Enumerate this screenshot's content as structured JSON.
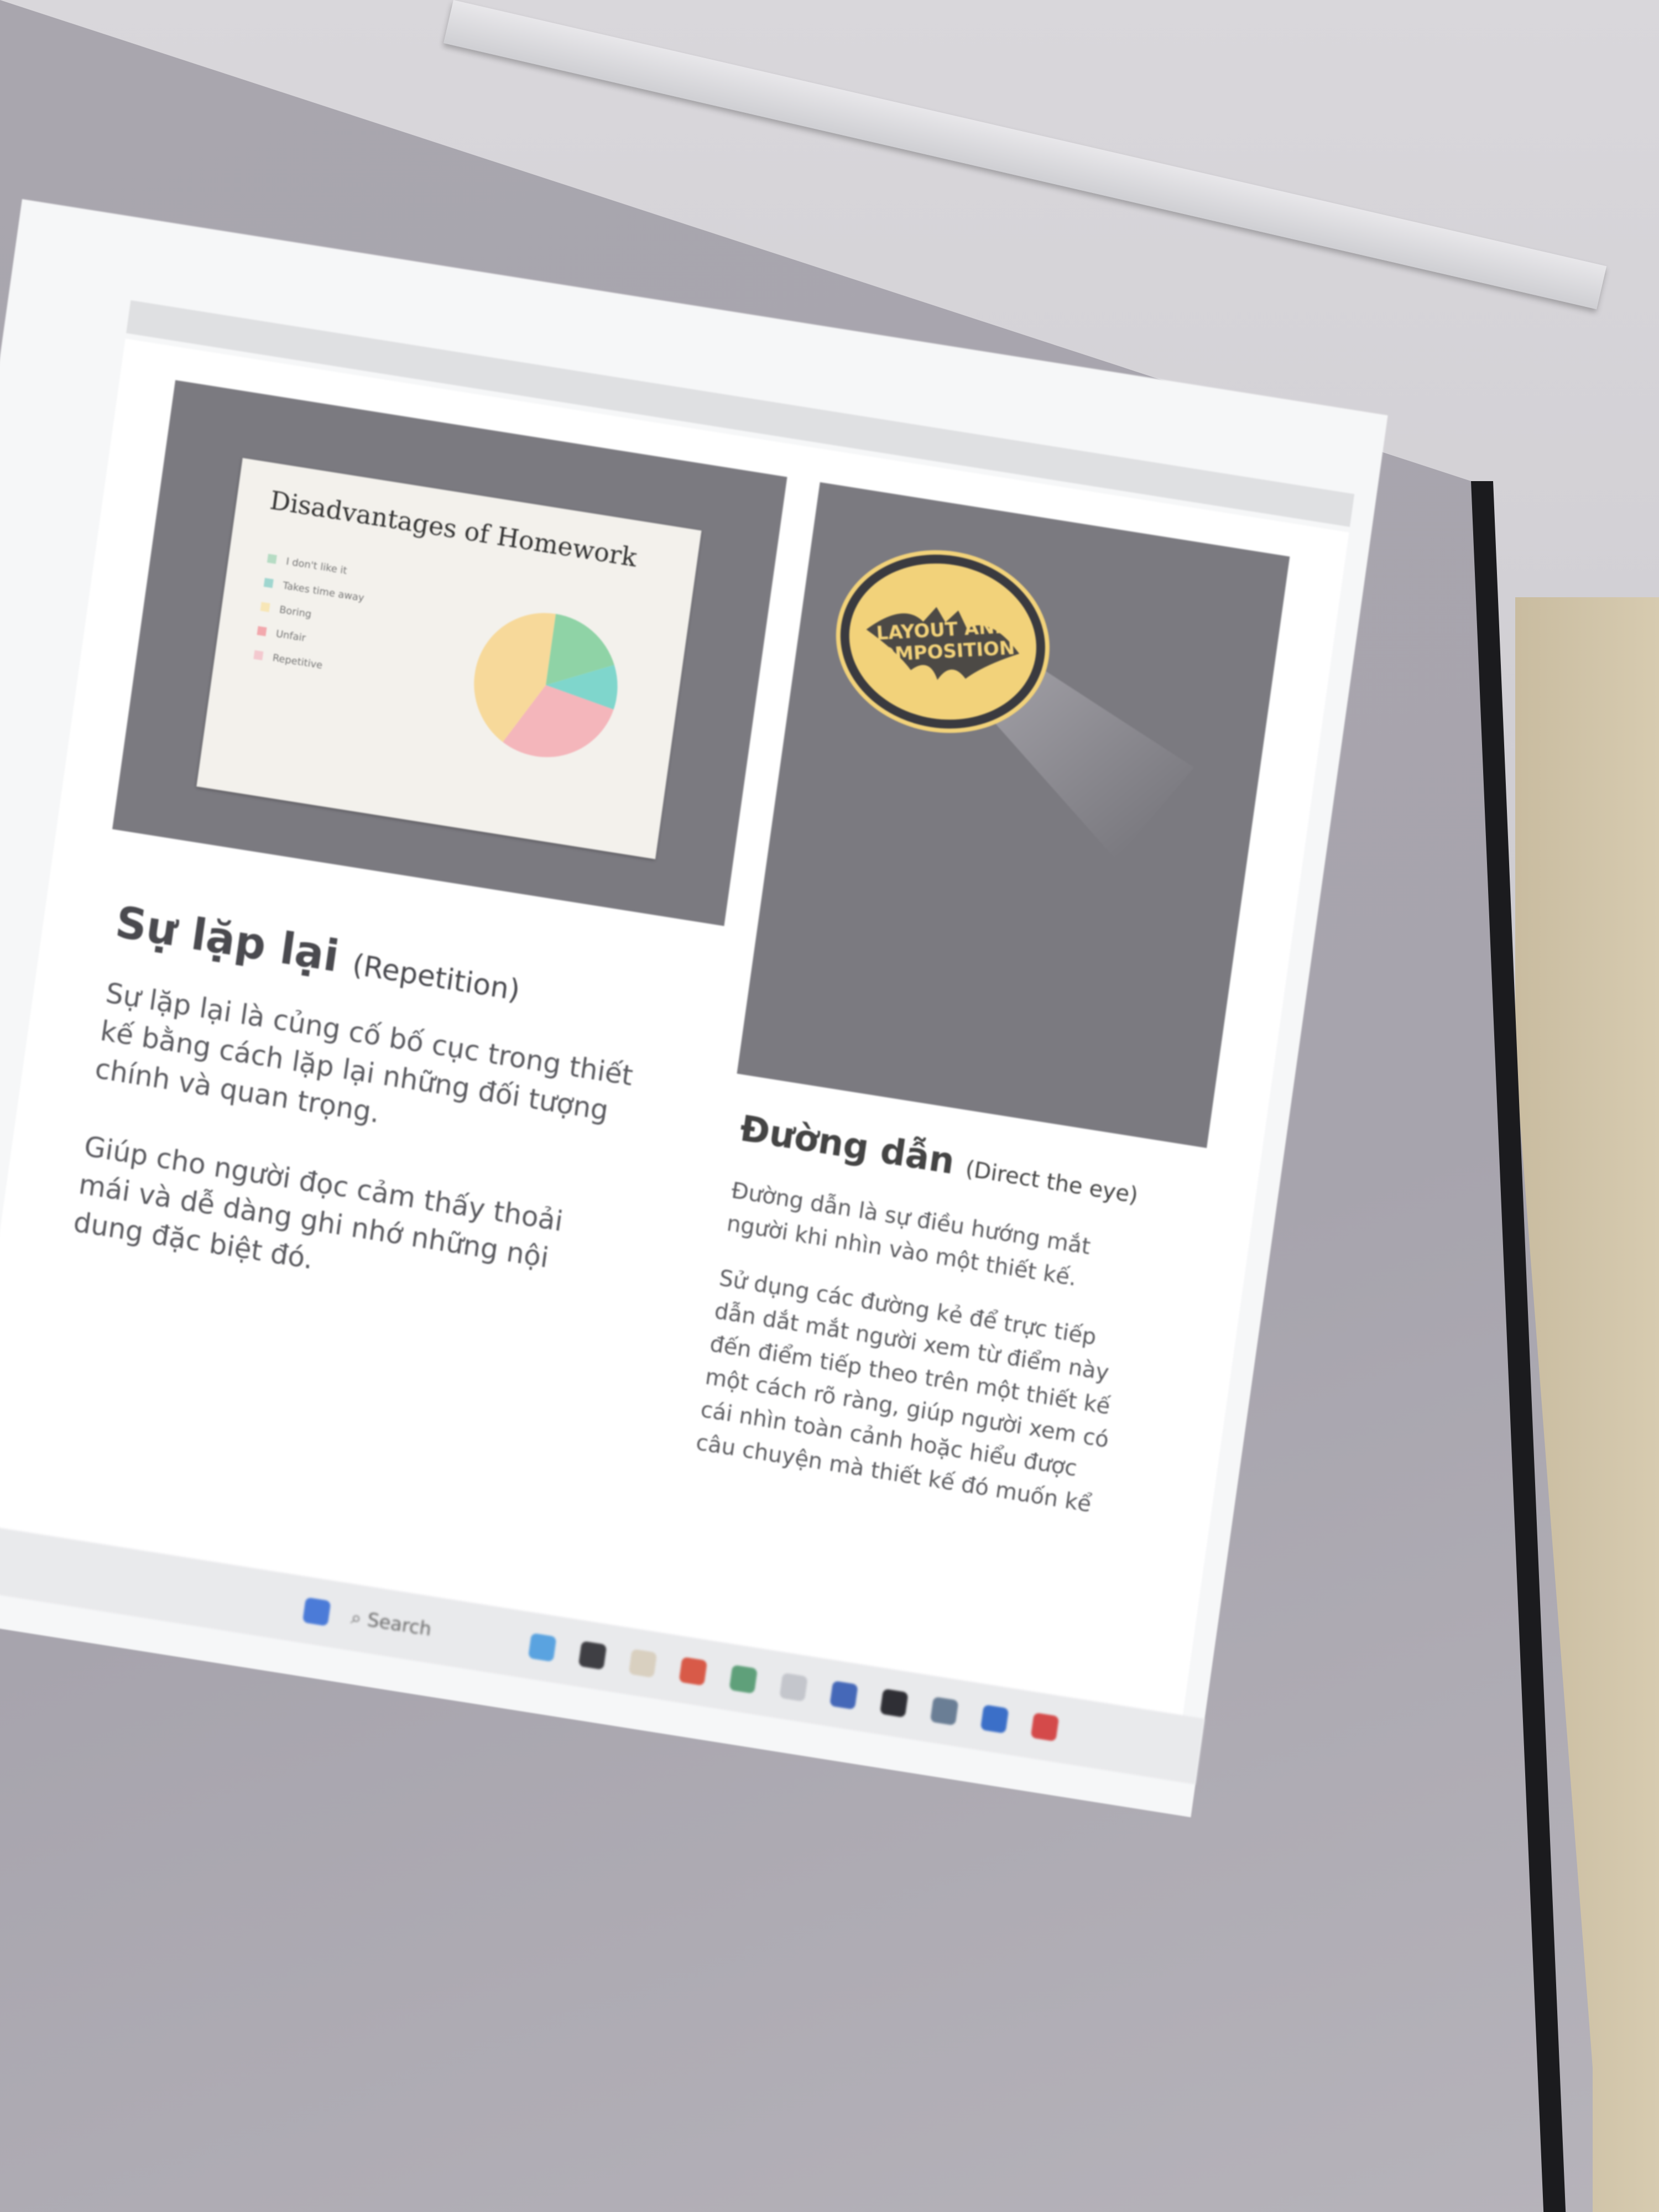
{
  "inner_slide": {
    "title": "Disadvantages of Homework",
    "legend": [
      "I don't like it",
      "Takes time away",
      "Boring",
      "Unfair",
      "Repetitive"
    ],
    "legend_colors": [
      "#b6dcc4",
      "#9fd6cf",
      "#f7e6b6",
      "#f2a8ad",
      "#f3c9cf"
    ],
    "pie_colors": [
      "#8fd3a6",
      "#7fd6cc",
      "#f4b6bb",
      "#f7d99a"
    ],
    "pie_values": [
      18,
      10,
      30,
      42
    ]
  },
  "logo": {
    "text_line1": "LAYOUT AND",
    "text_line2": "COMPOSITION"
  },
  "left_section": {
    "heading": "Sự lặp lại",
    "heading_sub": "(Repetition)",
    "para1": "Sự lặp lại là củng cố bố cục trong thiết kế bằng cách lặp lại những đối tượng chính và quan trọng.",
    "para2": "Giúp cho người đọc cảm thấy thoải mái và dễ dàng ghi nhớ những nội dung đặc biệt đó."
  },
  "right_section": {
    "heading": "Đường dẫn",
    "heading_sub": "(Direct the eye)",
    "para1": "Đường dẫn là sự điều hướng mắt người khi nhìn vào một thiết kế.",
    "para2": "Sử dụng các đường kẻ để trực tiếp dẫn dắt mắt người xem từ điểm này đến điểm tiếp theo trên một thiết kế một cách rõ ràng, giúp người xem có cái nhìn toàn cảnh hoặc hiểu được câu chuyện mà thiết kế đó muốn kể"
  },
  "taskbar": {
    "search_label": "Search"
  },
  "colors": {
    "logo_yellow": "#f2d27a",
    "slide_bg": "#7b7a80"
  }
}
